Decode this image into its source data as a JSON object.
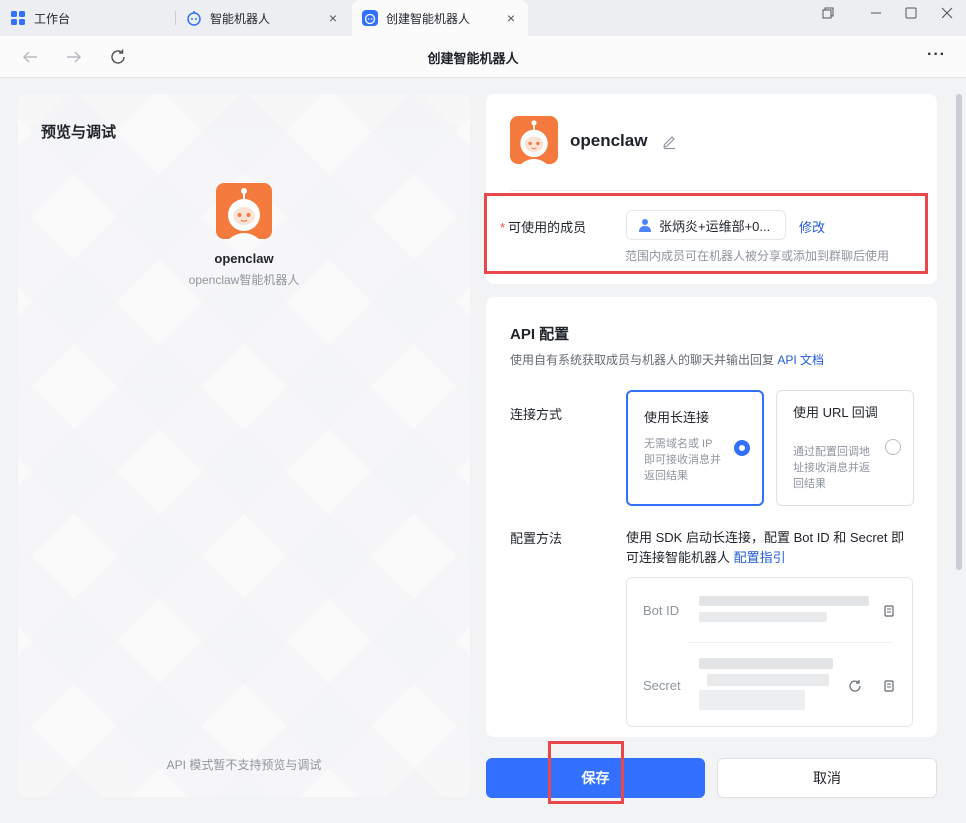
{
  "tabs": [
    {
      "label": "工作台",
      "icon": "grid-icon"
    },
    {
      "label": "智能机器人",
      "icon": "robot-icon"
    },
    {
      "label": "创建智能机器人",
      "icon": "robot-icon",
      "active": true
    }
  ],
  "toolbar": {
    "title": "创建智能机器人"
  },
  "preview": {
    "title": "预览与调试",
    "bot_name": "openclaw",
    "bot_desc": "openclaw智能机器人",
    "note": "API 模式暂不支持预览与调试"
  },
  "bot": {
    "name": "openclaw"
  },
  "members": {
    "required_mark": "*",
    "label": "可使用的成员",
    "value": "张炳炎+运维部+0...",
    "modify": "修改",
    "hint": "范围内成员可在机器人被分享或添加到群聊后使用"
  },
  "api": {
    "title": "API 配置",
    "desc": "使用自有系统获取成员与机器人的聊天并输出回复",
    "doc_link": "API 文档",
    "conn_label": "连接方式",
    "options": [
      {
        "title": "使用长连接",
        "sub": "无需域名或 IP 即可接收消息并返回结果",
        "selected": true
      },
      {
        "title": "使用 URL 回调",
        "sub": "通过配置回调地址接收消息并返回结果",
        "selected": false
      }
    ],
    "cfg_label": "配置方法",
    "cfg_desc": "使用 SDK 启动长连接，配置 Bot ID 和 Secret 即可连接智能机器人",
    "cfg_link": "配置指引",
    "bot_id_label": "Bot ID",
    "secret_label": "Secret"
  },
  "buttons": {
    "save": "保存",
    "cancel": "取消"
  },
  "colors": {
    "accent": "#3370ff",
    "avatar": "#f47a3d",
    "highlight": "#e8474c"
  }
}
